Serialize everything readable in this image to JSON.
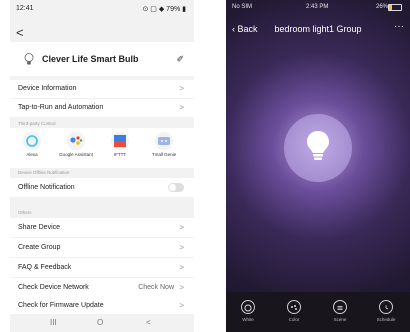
{
  "left": {
    "status": {
      "time": "12:41",
      "icons": "⊙ ▢ ◆ 79% ▮"
    },
    "back_glyph": "<",
    "device": {
      "name": "Clever Life Smart Bulb",
      "edit_glyph": "✐"
    },
    "rows_top": [
      {
        "label": "Device Information"
      },
      {
        "label": "Tap-to-Run and Automation"
      }
    ],
    "third_party_section": "Third-party Control",
    "third_party": [
      {
        "name": "Alexa",
        "icon": "alexa-icon"
      },
      {
        "name": "Google Assistant",
        "icon": "google-assistant-icon"
      },
      {
        "name": "IFTTT",
        "icon": "ifttt-icon"
      },
      {
        "name": "Tmall Genie",
        "icon": "tmall-genie-icon"
      }
    ],
    "offline_section": "Device Offline Notification",
    "offline_label": "Offline Notification",
    "others_section": "Others",
    "rows_others": [
      {
        "label": "Share Device",
        "value": ""
      },
      {
        "label": "Create Group",
        "value": ""
      },
      {
        "label": "FAQ & Feedback",
        "value": ""
      },
      {
        "label": "Check Device Network",
        "value": "Check Now"
      },
      {
        "label": "Check for Firmware Update",
        "value": ""
      }
    ],
    "chevron": ">",
    "nav": {
      "recent": "III",
      "home": "O",
      "back": "<"
    }
  },
  "right": {
    "status": {
      "carrier": "No SIM",
      "time": "2:43 PM",
      "battery": "26%",
      "battery_level": 0.26
    },
    "header": {
      "back": "Back",
      "title": "bedroom light1 Group",
      "more": "···"
    },
    "tabs": [
      {
        "label": "White",
        "icon": "white-mode-icon"
      },
      {
        "label": "Color",
        "icon": "palette-icon"
      },
      {
        "label": "Scene",
        "icon": "scene-icon"
      },
      {
        "label": "Schedule",
        "icon": "clock-icon"
      }
    ],
    "colors": {
      "accent": "#f4c34a",
      "tabbar": "#18151d"
    }
  }
}
